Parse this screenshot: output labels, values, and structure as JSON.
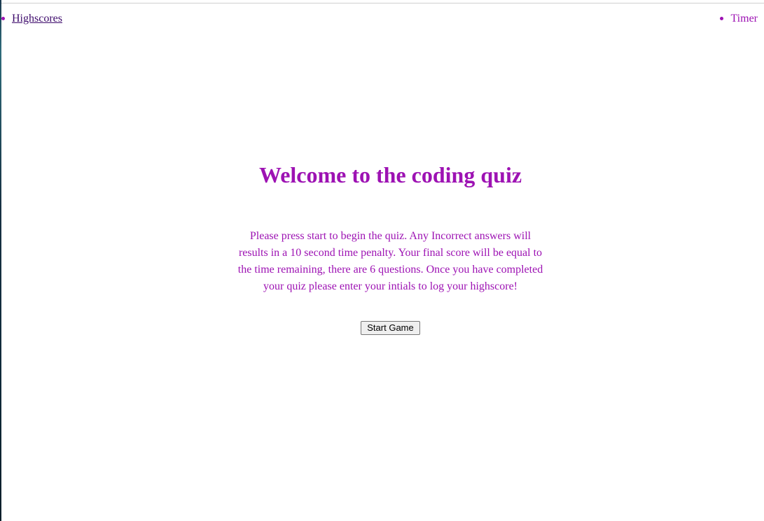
{
  "nav": {
    "highscores_label": "Highscores",
    "timer_label": "Timer"
  },
  "main": {
    "title": "Welcome to the coding quiz",
    "instructions": "Please press start to begin the quiz. Any Incorrect answers will results in a 10 second time penalty. Your final score will be equal to the time remaining, there are 6 questions. Once you have completed your quiz please enter your intials to log your highscore!",
    "start_button_label": "Start Game"
  },
  "colors": {
    "accent": "#9d12b3",
    "link": "#3d0a6b"
  }
}
